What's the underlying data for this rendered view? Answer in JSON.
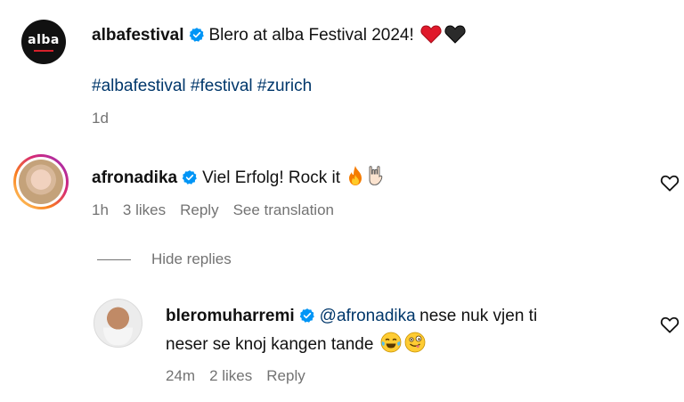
{
  "post": {
    "username": "albafestival",
    "avatar_text": "alba",
    "caption": "Blero at alba Festival 2024!",
    "caption_emojis": [
      "red-heart",
      "black-heart"
    ],
    "hashtags": "#albafestival #festival #zurich",
    "time": "1d"
  },
  "comment": {
    "username": "afronadika",
    "text": "Viel Erfolg! Rock it",
    "emojis": [
      "fire",
      "rock-on-hand"
    ],
    "time": "1h",
    "likes": "3 likes",
    "reply_label": "Reply",
    "translate_label": "See translation"
  },
  "hide_replies_label": "Hide replies",
  "reply": {
    "username": "bleromuharremi",
    "mention": "@afronadika",
    "text_line1": "nese nuk vjen ti",
    "text_line2": "neser se knoj kangen tande",
    "emojis": [
      "tears-of-joy",
      "zany-face"
    ],
    "time": "24m",
    "likes": "2 likes",
    "reply_label": "Reply"
  },
  "colors": {
    "verified": "#0095f6",
    "meta_gray": "#737373",
    "hashtag": "#00376b",
    "story_ring_start": "#feda75",
    "story_ring_end": "#d62976"
  }
}
